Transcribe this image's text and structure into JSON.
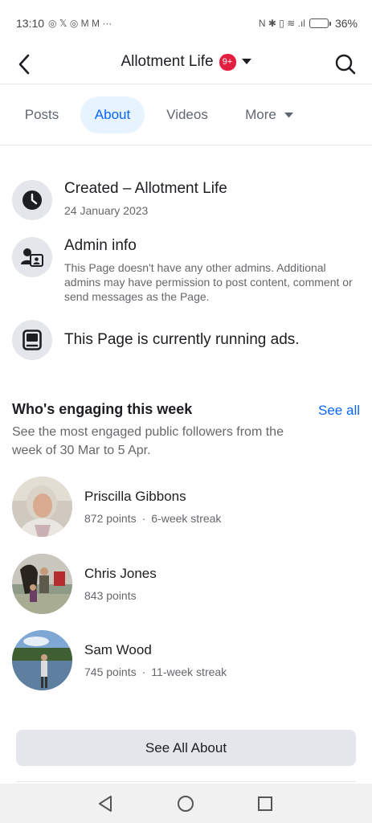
{
  "status_bar": {
    "time": "13:10",
    "left_glyphs": "◎ 𝕏 ◎ M M ···",
    "right_glyphs": "N ✱ ▯ ≋ .ıl",
    "battery_percent": "36%",
    "battery_level": 0.36
  },
  "header": {
    "title": "Allotment Life",
    "badge": "9+",
    "back_icon": "back-arrow-icon",
    "search_icon": "search-icon",
    "dropdown_icon": "caret-down-icon"
  },
  "tabs": [
    {
      "label": "Posts",
      "active": false
    },
    {
      "label": "About",
      "active": true
    },
    {
      "label": "Videos",
      "active": false
    },
    {
      "label": "More",
      "active": false
    }
  ],
  "info": {
    "created": {
      "title": "Created – Allotment Life",
      "date": "24 January 2023",
      "icon": "clock-icon"
    },
    "admin": {
      "title": "Admin info",
      "description": "This Page doesn't have any other admins. Additional admins may have permission to post content, comment or send messages as the Page.",
      "icon": "admin-icon"
    },
    "ads": {
      "title": "This Page is currently running ads.",
      "icon": "ads-icon"
    }
  },
  "engaging": {
    "title": "Who's engaging this week",
    "see_all": "See all",
    "subtitle": "See the most engaged public followers from the week of 30 Mar to 5 Apr.",
    "people": [
      {
        "name": "Priscilla Gibbons",
        "points": "872 points",
        "separator": "·",
        "streak": "6-week streak"
      },
      {
        "name": "Chris Jones",
        "points": "843 points",
        "separator": "",
        "streak": ""
      },
      {
        "name": "Sam Wood",
        "points": "745 points",
        "separator": "·",
        "streak": "11-week streak"
      }
    ]
  },
  "footer_button": "See All About",
  "accent_color": "#0866ff",
  "badge_color": "#e41e3f"
}
